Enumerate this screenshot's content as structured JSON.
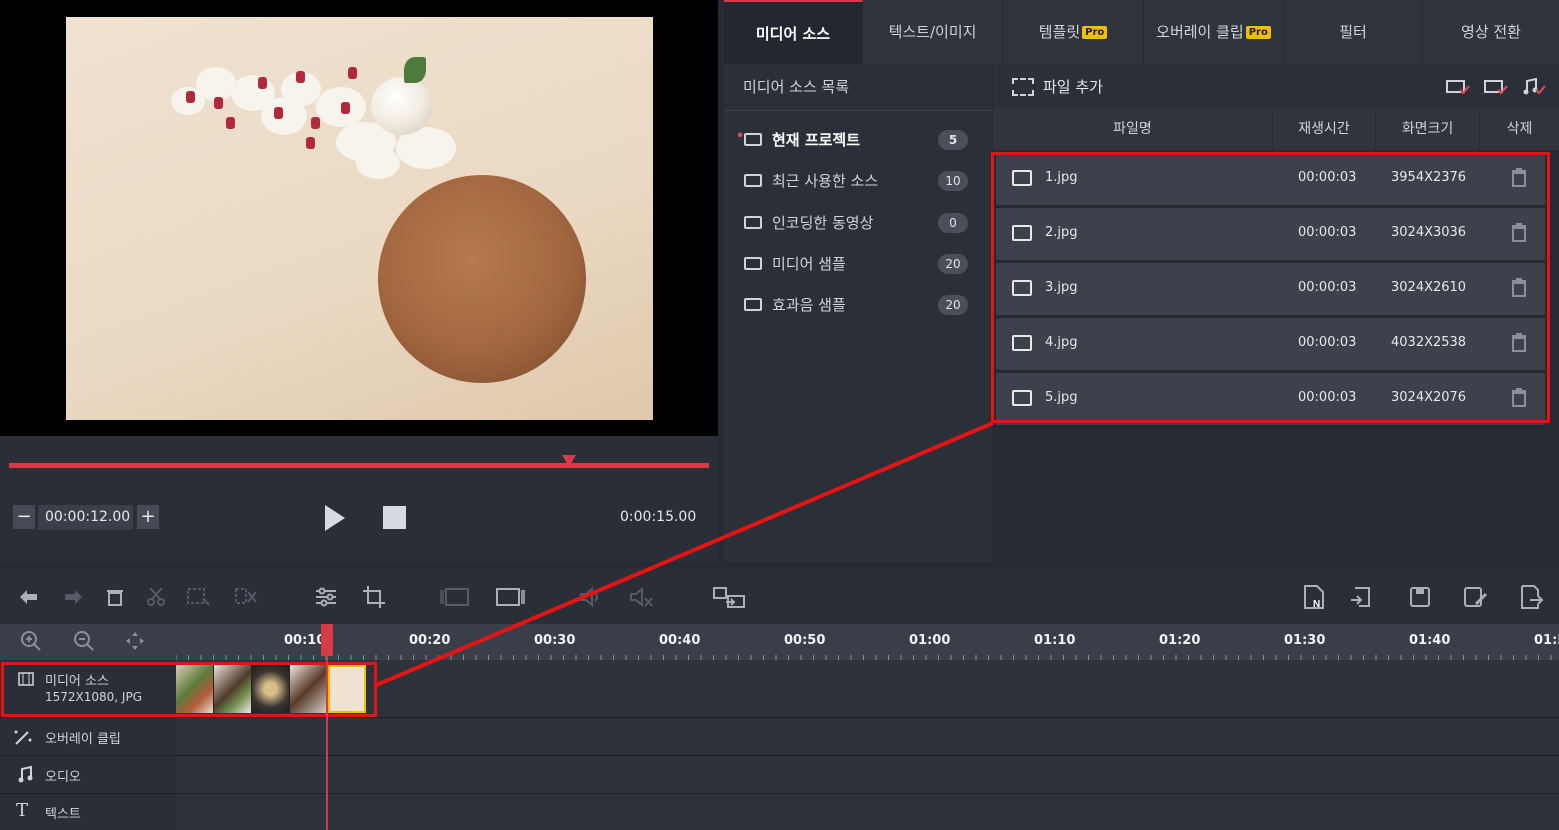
{
  "player": {
    "current_time": "00:00:12.00",
    "total_time": "0:00:15.00",
    "minus": "−",
    "plus": "+",
    "progress_fraction": 0.8
  },
  "tabs": [
    {
      "label": "미디어 소스",
      "pro": ""
    },
    {
      "label": "텍스트/이미지",
      "pro": ""
    },
    {
      "label": "템플릿",
      "pro": "Pro"
    },
    {
      "label": "오버레이 클립",
      "pro": "Pro"
    },
    {
      "label": "필터",
      "pro": ""
    },
    {
      "label": "영상 전환",
      "pro": ""
    }
  ],
  "source_list": {
    "title": "미디어 소스 목록",
    "items": [
      {
        "label": "현재 프로젝트",
        "count": "5"
      },
      {
        "label": "최근 사용한 소스",
        "count": "10"
      },
      {
        "label": "인코딩한 동영상",
        "count": "0"
      },
      {
        "label": "미디어 샘플",
        "count": "20"
      },
      {
        "label": "효과음 샘플",
        "count": "20"
      }
    ]
  },
  "file_panel": {
    "add_label": "파일 추가",
    "headers": {
      "name": "파일명",
      "duration": "재생시간",
      "size": "화면크기",
      "delete": "삭제"
    },
    "files": [
      {
        "name": "1.jpg",
        "duration": "00:00:03",
        "size": "3954X2376"
      },
      {
        "name": "2.jpg",
        "duration": "00:00:03",
        "size": "3024X3036"
      },
      {
        "name": "3.jpg",
        "duration": "00:00:03",
        "size": "3024X2610"
      },
      {
        "name": "4.jpg",
        "duration": "00:00:03",
        "size": "4032X2538"
      },
      {
        "name": "5.jpg",
        "duration": "00:00:03",
        "size": "3024X2076"
      }
    ]
  },
  "timeline": {
    "ticks": [
      "00:10",
      "00:20",
      "00:30",
      "00:40",
      "00:50",
      "01:00",
      "01:10",
      "01:20",
      "01:30",
      "01:40",
      "01:5"
    ],
    "tracks": {
      "media_label": "미디어 소스",
      "media_sub": "1572X1080, JPG",
      "overlay_label": "오버레이 클립",
      "audio_label": "오디오",
      "text_label": "텍스트"
    }
  },
  "colors": {
    "accent": "#d83a48",
    "highlight": "#e51414",
    "pro_badge": "#f0c000"
  }
}
